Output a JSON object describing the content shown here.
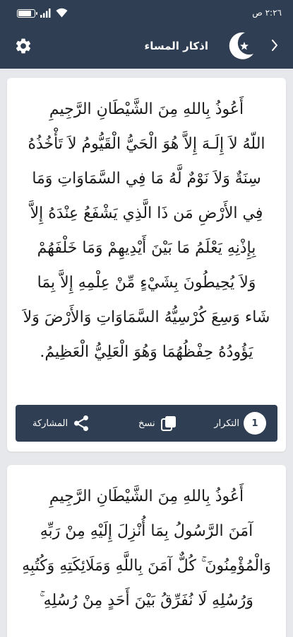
{
  "status_bar": {
    "time": "٢:٢٦ ص",
    "battery_level": 0.85
  },
  "header": {
    "title": "اذكار المساء",
    "back_icon": "chevron-right-icon",
    "logo_icon": "crescent-moon-star-icon",
    "settings_icon": "gear-icon"
  },
  "cards": [
    {
      "lines": [
        "أَعُوذُ بِاللهِ مِنَ الشَّيْطَانِ الرَّجِيمِ",
        "اللّهُ لاَ إِلَـهَ إِلاَّ هُوَ الْحَيُّ الْقَيُّومُ لاَ تَأْخُذُهُ",
        "سِنَةٌ وَلاَ نَوْمٌ لَّهُ مَا فِي السَّمَاوَاتِ وَمَا",
        "فِي الأَرْضِ مَن ذَا الَّذِي يَشْفَعُ عِنْدَهُ إِلاَّ",
        "بِإِذْنِهِ يَعْلَمُ مَا بَيْنَ أَيْدِيهِمْ وَمَا خَلْفَهُمْ",
        "وَلاَ يُحِيطُونَ بِشَيْءٍ مِّنْ عِلْمِهِ إِلاَّ بِمَا",
        "شَاء وَسِعَ كُرْسِيُّهُ السَّمَاوَاتِ وَالأَرْضَ وَلاَ",
        "يَؤُودُهُ حِفْظُهُمَا وَهُوَ الْعَلِيُّ الْعَظِيمُ."
      ],
      "actions": {
        "count": "1",
        "repeat_label": "التكرار",
        "copy_label": "نسخ",
        "share_label": "المشاركة"
      }
    },
    {
      "lines": [
        "أَعُوذُ بِاللهِ مِنَ الشَّيْطَانِ الرَّجِيمِ",
        "آمَنَ الرَّسُولُ بِمَا أُنْزِلَ إِلَيْهِ مِنْ رَبِّهِ",
        "وَالْمُؤْمِنُونَ ۚ كُلٌّ آمَنَ بِاللَّهِ وَمَلَائِكَتِهِ وَكُتُبِهِ",
        "وَرُسُلِهِ لَا نُفَرِّقُ بَيْنَ أَحَدٍ مِنْ رُسُلِهِ ۚ"
      ]
    }
  ],
  "colors": {
    "header_bg": "#2f3e52",
    "page_bg": "#e6e8eb",
    "card_bg": "#ffffff"
  }
}
